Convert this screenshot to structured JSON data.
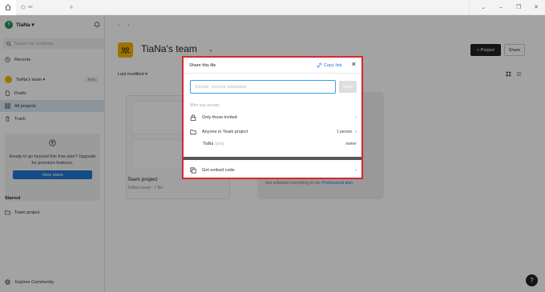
{
  "titlebar": {
    "tab_label": "oc",
    "new_tab": "+"
  },
  "sidebar": {
    "user_initial": "T",
    "username": "TiaNa ▾",
    "search_placeholder": "Search for anything",
    "recents": "Recents",
    "team_name": "TiaNa's team ▾",
    "free_badge": "Free",
    "drafts": "Drafts",
    "all_projects": "All projects",
    "trash": "Trash",
    "upsell_text": "Ready to go beyond this free plan? Upgrade for premium features.",
    "upsell_button": "View plans",
    "starred_heading": "Starred",
    "starred_item": "Team project",
    "explore": "Explore Community"
  },
  "main": {
    "back": "‹",
    "forward": "›",
    "team_title": "TiaNa's team",
    "team_chevron": "⌄",
    "new_project": "+ Project",
    "share": "Share",
    "sort_label": "Last modified ▾",
    "card_title": "Team project",
    "card_sub": "TiaNa's team · 1 file",
    "card2_text_prefix": "Get unlimited everything on the",
    "card2_link": "Professional plan",
    "help": "?"
  },
  "modal": {
    "title": "Share this file",
    "copy_link": "Copy link",
    "email_placeholder": "Emails, comma separated",
    "invite": "Invite",
    "access_label": "Who has access",
    "only_invited": "Only those invited",
    "team_access": "Anyone in Team project",
    "team_count": "1 person",
    "owner_name": "TiaNa",
    "owner_you": "(you)",
    "owner_role": "owner",
    "embed": "Get embed code"
  },
  "colors": {
    "accent": "#1e78d4",
    "highlight_border": "#d9262c",
    "team_yellow": "#f5b400",
    "avatar_green": "#2e8b57"
  }
}
